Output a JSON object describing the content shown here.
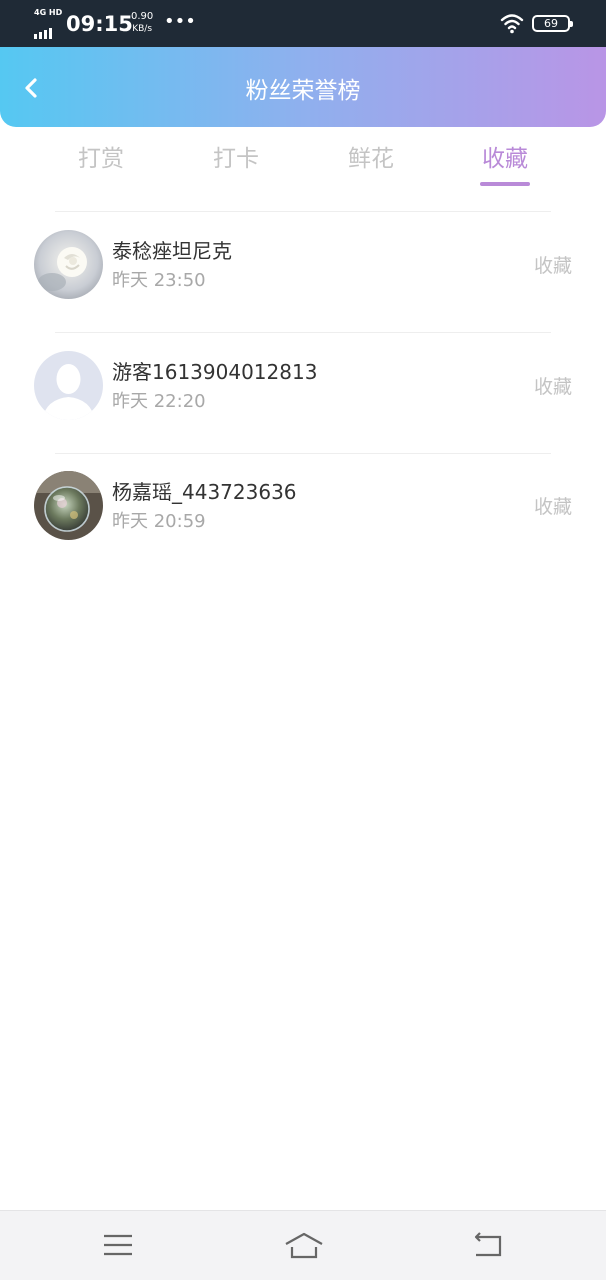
{
  "status_bar": {
    "network": "4G HD",
    "time": "09:15",
    "speed_value": "0.90",
    "speed_unit": "KB/s",
    "more": "•••",
    "battery": "69"
  },
  "header": {
    "title": "粉丝荣誉榜",
    "back_icon": "chevron-left-icon"
  },
  "tabs": [
    {
      "label": "打赏",
      "active": false
    },
    {
      "label": "打卡",
      "active": false
    },
    {
      "label": "鲜花",
      "active": false
    },
    {
      "label": "收藏",
      "active": true
    }
  ],
  "list": [
    {
      "name": "泰稔痤坦尼克",
      "time": "昨天 23:50",
      "action": "收藏",
      "avatar": "white-rose-photo"
    },
    {
      "name": "游客1613904012813",
      "time": "昨天 22:20",
      "action": "收藏",
      "avatar": "default-user-silhouette"
    },
    {
      "name": "杨嘉瑶_443723636",
      "time": "昨天 20:59",
      "action": "收藏",
      "avatar": "glass-globe-photo"
    }
  ],
  "nav_bar": {
    "menu_icon": "menu-icon",
    "home_icon": "home-icon",
    "back_icon": "back-icon"
  },
  "colors": {
    "header_gradient_start": "#55c8f2",
    "header_gradient_end": "#b995e6",
    "tab_active": "#b98ad8",
    "tab_inactive": "#c4c4c4"
  }
}
